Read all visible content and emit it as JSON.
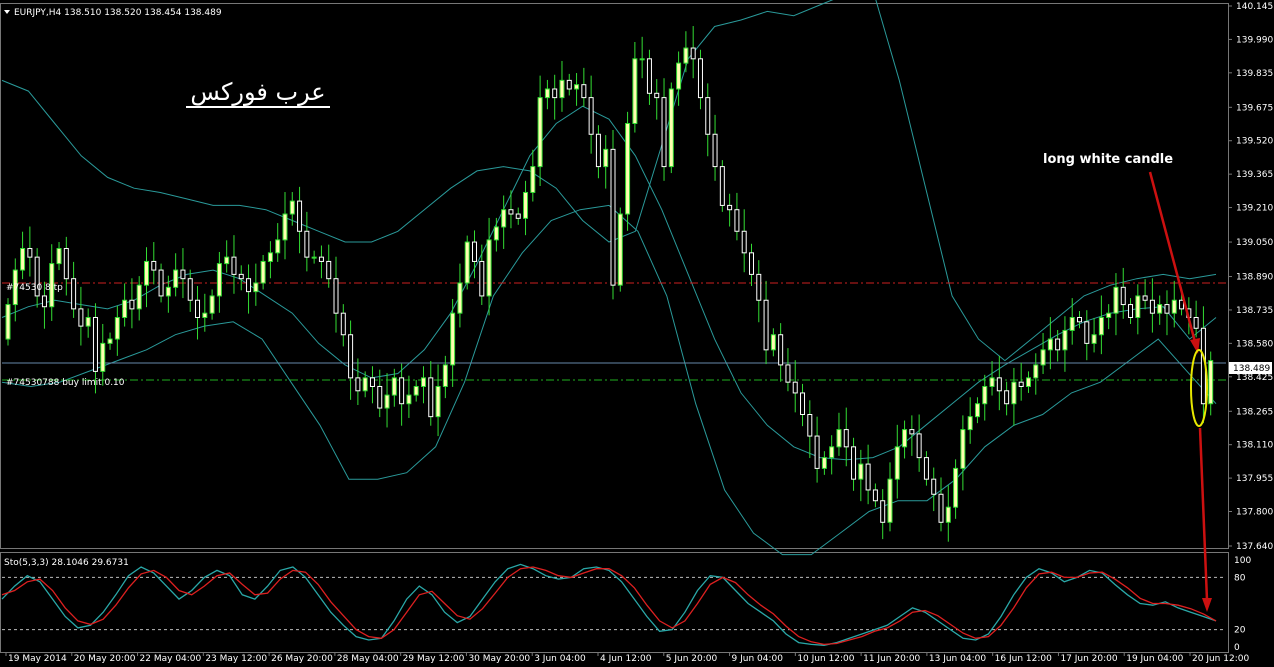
{
  "colors": {
    "background": "#000000",
    "bull_candle": "#ffffb0",
    "bear_candle": "#ffffff",
    "wick": "#33dd33",
    "bands": "#2a9a9a",
    "sell_level": "#cc2020",
    "buy_level": "#20b020",
    "bid_line": "#6688aa",
    "stoch_main": "#2aa8a8",
    "stoch_signal": "#dd2020",
    "arrow": "#cc1010",
    "ellipse": "#e8e800",
    "annotation": "#ffffff",
    "axis_text": "#ffffff"
  },
  "header": {
    "symbol_text": "EURJPY,H4  138.510 138.520 138.454 138.489",
    "dropdown_icon": "triangle-down-icon"
  },
  "watermark": "عرب فوركس",
  "annotation": {
    "text": "long white candle"
  },
  "price_label": "138.489",
  "order_labels": {
    "sell": "#74530 8  tp",
    "buy": "#74530788 buy limit 0.10"
  },
  "stoch_header": "Sto(5,3,3) 28.1046 29.6731",
  "chart_data": [
    {
      "type": "candlestick",
      "title": "EURJPY,H4",
      "ylim": [
        137.64,
        140.145
      ],
      "y_ticks": [
        "140.145",
        "139.990",
        "139.835",
        "139.675",
        "139.520",
        "139.365",
        "139.210",
        "139.050",
        "138.890",
        "138.735",
        "138.580",
        "138.425",
        "138.265",
        "138.110",
        "137.955",
        "137.800",
        "137.640"
      ],
      "x_ticks": [
        "19 May 2014",
        "20 May 20:00",
        "22 May 04:00",
        "23 May 12:00",
        "26 May 20:00",
        "28 May 04:00",
        "29 May 12:00",
        "30 May 20:00",
        "3 Jun 04:00",
        "4 Jun 12:00",
        "5 Jun 20:00",
        "9 Jun 04:00",
        "10 Jun 12:00",
        "11 Jun 20:00",
        "13 Jun 04:00",
        "16 Jun 12:00",
        "17 Jun 20:00",
        "19 Jun 04:00",
        "20 Jun 12:00"
      ],
      "close": [
        138.76,
        138.92,
        139.02,
        138.98,
        138.8,
        138.75,
        138.95,
        139.02,
        138.88,
        138.74,
        138.66,
        138.7,
        138.45,
        138.58,
        138.6,
        138.7,
        138.78,
        138.74,
        138.85,
        138.96,
        138.92,
        138.8,
        138.84,
        138.92,
        138.88,
        138.78,
        138.7,
        138.72,
        138.8,
        138.95,
        138.98,
        138.9,
        138.88,
        138.82,
        138.86,
        138.96,
        139.0,
        139.06,
        139.18,
        139.24,
        139.1,
        138.98,
        138.98,
        138.96,
        138.88,
        138.72,
        138.62,
        138.42,
        138.36,
        138.42,
        138.38,
        138.28,
        138.34,
        138.42,
        138.3,
        138.34,
        138.38,
        138.42,
        138.24,
        138.38,
        138.48,
        138.72,
        138.86,
        139.05,
        138.96,
        138.8,
        139.06,
        139.12,
        139.2,
        139.18,
        139.16,
        139.28,
        139.4,
        139.72,
        139.76,
        139.72,
        139.8,
        139.76,
        139.78,
        139.72,
        139.55,
        139.4,
        139.48,
        138.85,
        139.18,
        139.6,
        139.9,
        139.9,
        139.74,
        139.72,
        139.4,
        139.76,
        139.88,
        139.95,
        139.9,
        139.72,
        139.55,
        139.4,
        139.22,
        139.2,
        139.1,
        139.0,
        138.9,
        138.78,
        138.55,
        138.62,
        138.48,
        138.4,
        138.35,
        138.25,
        138.15,
        138.0,
        138.05,
        138.1,
        138.18,
        138.1,
        137.95,
        138.02,
        137.9,
        137.85,
        137.75,
        137.95,
        138.1,
        138.18,
        138.16,
        138.05,
        137.95,
        137.88,
        137.75,
        137.82,
        138.0,
        138.18,
        138.24,
        138.3,
        138.38,
        138.42,
        138.36,
        138.3,
        138.4,
        138.38,
        138.42,
        138.48,
        138.55,
        138.6,
        138.55,
        138.64,
        138.7,
        138.68,
        138.58,
        138.62,
        138.7,
        138.72,
        138.84,
        138.76,
        138.7,
        138.8,
        138.78,
        138.72,
        138.76,
        138.72,
        138.78,
        138.74,
        138.7,
        138.65,
        138.3,
        138.5
      ],
      "open": [
        138.6,
        138.76,
        138.92,
        139.02,
        138.98,
        138.8,
        138.75,
        138.95,
        139.02,
        138.88,
        138.74,
        138.66,
        138.7,
        138.45,
        138.58,
        138.6,
        138.7,
        138.78,
        138.74,
        138.85,
        138.96,
        138.92,
        138.8,
        138.84,
        138.92,
        138.88,
        138.78,
        138.7,
        138.72,
        138.8,
        138.95,
        138.98,
        138.9,
        138.88,
        138.82,
        138.86,
        138.96,
        139.0,
        139.06,
        139.18,
        139.24,
        139.1,
        138.98,
        138.98,
        138.96,
        138.88,
        138.72,
        138.62,
        138.42,
        138.36,
        138.42,
        138.38,
        138.28,
        138.34,
        138.42,
        138.3,
        138.34,
        138.38,
        138.42,
        138.24,
        138.38,
        138.48,
        138.72,
        138.86,
        139.05,
        138.96,
        138.8,
        139.06,
        139.12,
        139.2,
        139.18,
        139.16,
        139.28,
        139.4,
        139.72,
        139.76,
        139.72,
        139.8,
        139.76,
        139.78,
        139.72,
        139.55,
        139.4,
        139.48,
        138.85,
        139.18,
        139.6,
        139.9,
        139.9,
        139.74,
        139.72,
        139.4,
        139.76,
        139.88,
        139.95,
        139.9,
        139.72,
        139.55,
        139.4,
        139.22,
        139.2,
        139.1,
        139.0,
        138.9,
        138.78,
        138.55,
        138.62,
        138.48,
        138.4,
        138.35,
        138.25,
        138.15,
        138.0,
        138.05,
        138.1,
        138.18,
        138.1,
        137.95,
        138.02,
        137.9,
        137.85,
        137.75,
        137.95,
        138.1,
        138.18,
        138.16,
        138.05,
        137.95,
        137.88,
        137.75,
        137.82,
        138.0,
        138.18,
        138.24,
        138.3,
        138.38,
        138.42,
        138.36,
        138.3,
        138.4,
        138.38,
        138.42,
        138.48,
        138.55,
        138.6,
        138.55,
        138.64,
        138.7,
        138.68,
        138.58,
        138.62,
        138.7,
        138.72,
        138.84,
        138.76,
        138.7,
        138.8,
        138.78,
        138.72,
        138.76,
        138.72,
        138.78,
        138.74,
        138.7,
        138.65,
        138.3
      ],
      "bands_upper": [
        139.8,
        139.75,
        139.6,
        139.45,
        139.35,
        139.3,
        139.28,
        139.25,
        139.22,
        139.22,
        139.2,
        139.15,
        139.1,
        139.05,
        139.05,
        139.1,
        139.2,
        139.3,
        139.38,
        139.4,
        139.38,
        139.3,
        139.15,
        139.05,
        139.1,
        139.5,
        139.9,
        140.05,
        140.08,
        140.12,
        140.1,
        140.15,
        140.2,
        140.22,
        139.8,
        139.3,
        138.8,
        138.6,
        138.5,
        138.6,
        138.7,
        138.8,
        138.85,
        138.88,
        138.9,
        138.88,
        138.9
      ],
      "bands_middle": [
        138.7,
        138.75,
        138.78,
        138.76,
        138.74,
        138.78,
        138.85,
        138.9,
        138.92,
        138.88,
        138.8,
        138.72,
        138.58,
        138.48,
        138.42,
        138.44,
        138.55,
        138.72,
        138.95,
        139.2,
        139.45,
        139.6,
        139.68,
        139.62,
        139.45,
        139.2,
        138.9,
        138.6,
        138.35,
        138.2,
        138.1,
        138.05,
        138.04,
        138.05,
        138.1,
        138.2,
        138.3,
        138.4,
        138.48,
        138.55,
        138.62,
        138.68,
        138.72,
        138.74,
        138.75,
        138.6,
        138.7
      ],
      "bands_lower": [
        138.4,
        138.38,
        138.4,
        138.45,
        138.5,
        138.55,
        138.62,
        138.66,
        138.68,
        138.6,
        138.4,
        138.2,
        137.95,
        137.95,
        137.98,
        138.1,
        138.4,
        138.8,
        139.0,
        139.15,
        139.2,
        139.22,
        139.1,
        138.8,
        138.3,
        137.9,
        137.7,
        137.6,
        137.6,
        137.7,
        137.8,
        137.85,
        137.85,
        137.95,
        138.1,
        138.2,
        138.25,
        138.35,
        138.4,
        138.5,
        138.6,
        138.45,
        138.3
      ],
      "sell_level": 138.86,
      "buy_level": 138.41,
      "bid": 138.489
    },
    {
      "type": "line",
      "title": "Sto(5,3,3) 28.1046 29.6731",
      "ylim": [
        0,
        100
      ],
      "y_ticks": [
        "100",
        "80",
        "20",
        "0"
      ],
      "levels": [
        80,
        20
      ],
      "series": [
        {
          "values": [
            55,
            70,
            82,
            75,
            55,
            35,
            22,
            25,
            40,
            60,
            82,
            92,
            85,
            70,
            55,
            65,
            80,
            88,
            82,
            60,
            55,
            70,
            88,
            92,
            80,
            60,
            40,
            25,
            12,
            8,
            10,
            30,
            55,
            70,
            60,
            40,
            28,
            35,
            55,
            75,
            90,
            95,
            90,
            82,
            78,
            80,
            90,
            92,
            88,
            75,
            55,
            35,
            18,
            20,
            40,
            65,
            82,
            80,
            65,
            50,
            40,
            30,
            15,
            5,
            3,
            2,
            5,
            10,
            15,
            20,
            25,
            35,
            45,
            40,
            30,
            20,
            10,
            8,
            15,
            35,
            60,
            80,
            90,
            85,
            75,
            80,
            88,
            85,
            72,
            60,
            50,
            48,
            52,
            45,
            40,
            35,
            30
          ]
        },
        {
          "values": [
            60,
            65,
            75,
            78,
            65,
            45,
            30,
            26,
            32,
            48,
            68,
            84,
            88,
            80,
            65,
            60,
            70,
            82,
            85,
            72,
            60,
            62,
            78,
            88,
            86,
            72,
            52,
            36,
            20,
            12,
            10,
            20,
            40,
            60,
            64,
            50,
            36,
            32,
            44,
            62,
            80,
            90,
            92,
            88,
            82,
            80,
            85,
            90,
            90,
            82,
            68,
            48,
            30,
            22,
            30,
            50,
            72,
            80,
            74,
            60,
            48,
            38,
            24,
            12,
            6,
            3,
            4,
            8,
            12,
            18,
            22,
            30,
            40,
            42,
            36,
            26,
            16,
            10,
            12,
            25,
            45,
            68,
            84,
            86,
            80,
            80,
            85,
            86,
            78,
            68,
            56,
            50,
            50,
            48,
            44,
            38,
            30
          ]
        }
      ]
    }
  ]
}
